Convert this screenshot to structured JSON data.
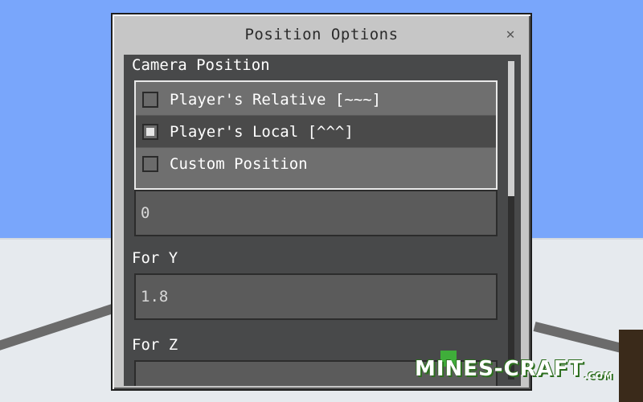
{
  "dialog": {
    "title": "Position Options",
    "close_symbol": "✕"
  },
  "camera_position": {
    "label": "Camera Position",
    "options": [
      {
        "label": "Player's Relative [~~~]",
        "checked": false
      },
      {
        "label": "Player's Local [^^^]",
        "checked": true
      },
      {
        "label": "Custom Position",
        "checked": false
      }
    ]
  },
  "fields": {
    "x_value": "0",
    "y_label": "For Y",
    "y_value": "1.8",
    "z_label": "For Z",
    "z_value": ""
  },
  "watermark": {
    "text": "MINES-CRAFT",
    "suffix": ".COM"
  },
  "colors": {
    "sky": "#79a6fb",
    "snow": "#e6eaee",
    "panel": "#48494a",
    "dialog": "#c6c6c6"
  }
}
